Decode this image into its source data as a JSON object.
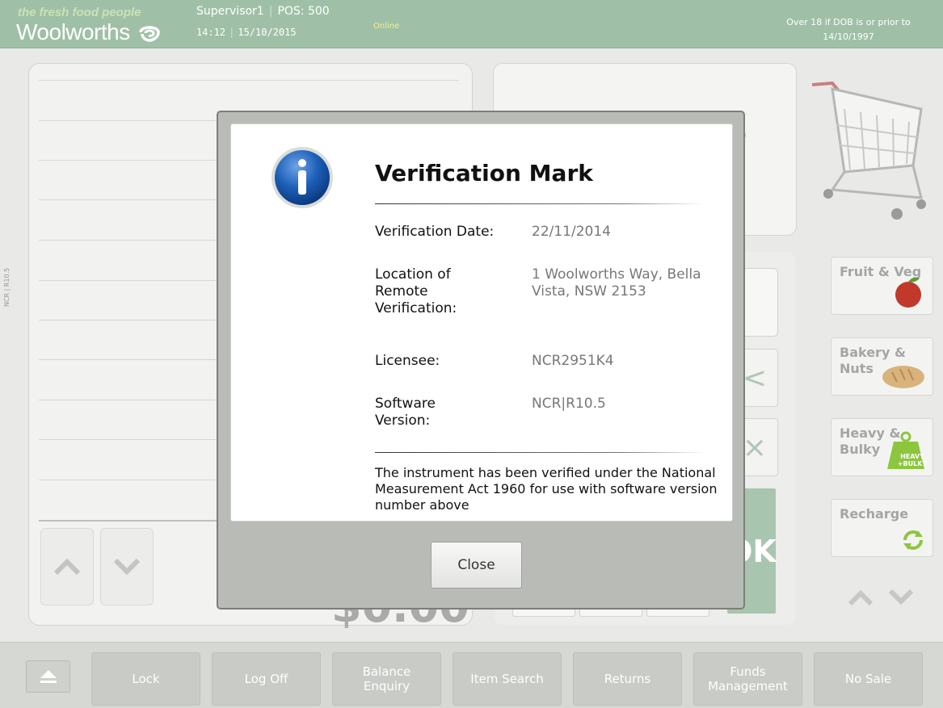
{
  "header": {
    "tagline": "the fresh food people",
    "brand": "Woolworths",
    "user": "Supervisor1",
    "pos": "POS: 500",
    "time": "14:12",
    "date": "15/10/2015",
    "status": "Online",
    "age_line1": "Over 18 if DOB is or prior to",
    "age_line2": "14/10/1997"
  },
  "side_label": "NCR | R10.5",
  "background": {
    "total_partial": "$0.00",
    "mid_buttons": [
      "<",
      "×"
    ],
    "ok_label": "OK",
    "categories": [
      {
        "label": "Fruit & Veg"
      },
      {
        "label": "Bakery & Nuts"
      },
      {
        "label": "Heavy & Bulky",
        "badge": "HEAVY +BULKY"
      },
      {
        "label": "Recharge"
      }
    ]
  },
  "toolbar": {
    "buttons": [
      "Lock",
      "Log Off",
      "Balance Enquiry",
      "Item Search",
      "Returns",
      "Funds Management",
      "No Sale"
    ]
  },
  "modal": {
    "title": "Verification Mark",
    "fields": [
      {
        "label": "Verification Date:",
        "value": "22/11/2014"
      },
      {
        "label": "Location of Remote Verification:",
        "value": "1 Woolworths Way, Bella Vista, NSW 2153"
      },
      {
        "label": "Licensee:",
        "value": "NCR2951K4"
      },
      {
        "label": "Software Version:",
        "value": "NCR|R10.5"
      }
    ],
    "note": "The instrument has been verified under the National Measurement Act 1960 for use with software version number above",
    "close_label": "Close"
  },
  "colors": {
    "header_bg": "#9fc0a7",
    "accent_green": "#a8c5b0",
    "info_blue": "#1d5fb8"
  }
}
